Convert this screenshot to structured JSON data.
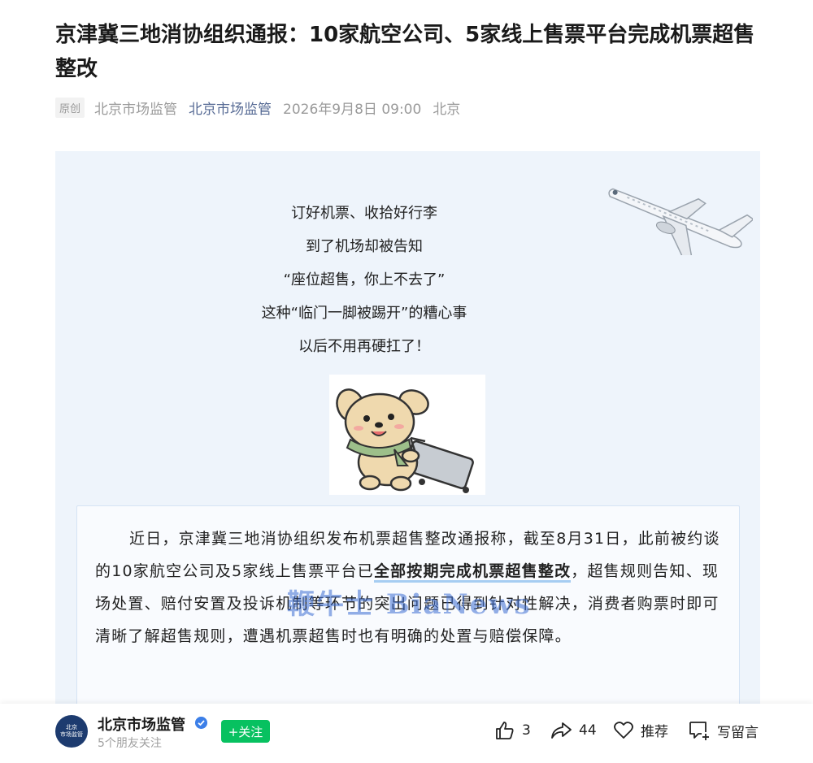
{
  "article": {
    "title": "京津冀三地消协组织通报：10家航空公司、5家线上售票平台完成机票超售整改",
    "meta": {
      "tag": "原创",
      "author": "北京市场监管",
      "account": "北京市场监管",
      "datetime": "2026年9月8日 09:00",
      "location": "北京"
    },
    "intro_lines": [
      "订好机票、收拾好行李",
      "到了机场却被告知",
      "“座位超售，你上不去了”",
      "这种“临门一脚被踢开”的糟心事",
      "以后不用再硬扛了！"
    ],
    "body": {
      "before": "近日，京津冀三地消协组织发布机票超售整改通报称，截至8月31日，此前被约谈的10家航空公司及5家线上售票平台已",
      "highlight": "全部按期完成机票超售整改",
      "after": "，超售规则告知、现场处置、赔付安置及投诉机制等环节的突出问题已得到针对性解决，消费者购票时即可清晰了解超售规则，遭遇机票超售时也有明确的处置与赔偿保障。"
    },
    "watermark": "鞭牛士 BiaNews"
  },
  "footer": {
    "avatar_line1": "北京",
    "avatar_line2": "市场监管",
    "account_name": "北京市场监管",
    "followers": "5个朋友关注",
    "follow_label": "+关注",
    "likes": "3",
    "shares": "44",
    "recommend_label": "推荐",
    "comment_label": "写留言"
  },
  "colors": {
    "panel_bg": "#eef4fb",
    "link": "#576b95",
    "follow_green": "#07c160",
    "highlight_underline": "#a6cdf2"
  },
  "icons": [
    "airplane-icon",
    "dog-sticker-icon",
    "verified-icon",
    "thumbs-up-icon",
    "share-icon",
    "heart-icon",
    "comment-icon"
  ]
}
